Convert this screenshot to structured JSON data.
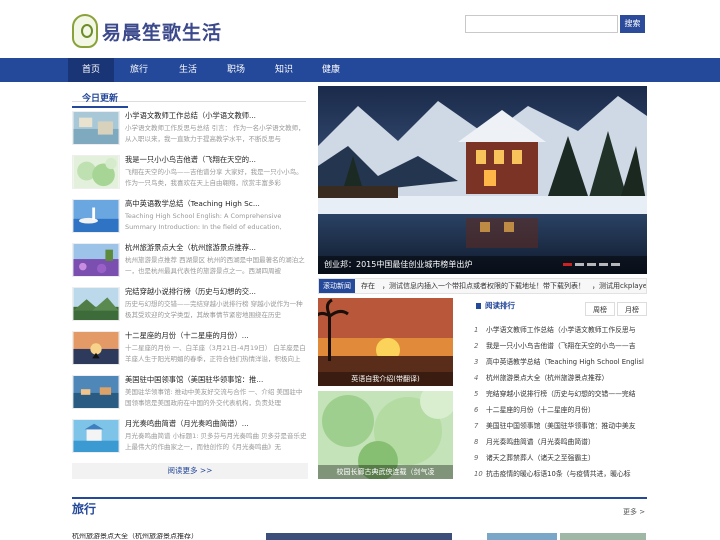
{
  "header": {
    "logo_text": "易晨笙歌生活",
    "search_placeholder": "",
    "search_button": "搜索"
  },
  "nav": [
    "首页",
    "旅行",
    "生活",
    "职场",
    "知识",
    "健康"
  ],
  "today": {
    "title": "今日更新",
    "items": [
      {
        "title": "小学语文教师工作总结（小学语文教师...",
        "desc": "小学语文教师工作反思与总结 引言： 作为一名小学语文教师，从入职以来，我一直致力于提高教学水平，不断反思与"
      },
      {
        "title": "我是一只小小鸟吉他谱（飞翔在天空的...",
        "desc": "飞翔在天空的小鸟——吉他谱分享 大家好，我是一只小小鸟。作为一只鸟类，我喜欢在天上自由翱翔，欣赏丰富多彩"
      },
      {
        "title": "高中英语教学总结（Teaching High Sc...",
        "desc": "Teaching High School English: A Comprehensive Summary Introduction: In the field of education, teaching"
      },
      {
        "title": "杭州旅游景点大全（杭州旅游景点推荐...",
        "desc": "杭州旅游景点推荐 西湖景区 杭州的西湖是中国最著名的湖泊之一，也是杭州最具代表性的旅游景点之一。西湖四周被"
      },
      {
        "title": "完结穿越小说排行榜（历史与幻想的交...",
        "desc": "历史与幻想的交错——完结穿越小说排行榜 穿越小说作为一种极其受欢迎的文学类型，其故事情节紧密地围绕在历史"
      },
      {
        "title": "十二星座的月份（十二星座的月份）...",
        "desc": "十二星座的月份 一、白羊座（3月21日-4月19日） 白羊座是白羊座人生于阳光明媚的春季，正符合他们热情洋溢，积极向上"
      },
      {
        "title": "美国驻中国领事馆（美国驻华领事馆：推...",
        "desc": "美国驻华领事馆: 推动中美友好交流与合作 一、介绍 美国驻中国领事馆是美国政府在中国的外交代表机构，负责处理"
      },
      {
        "title": "月光奏鸣曲简谱（月光奏鸣曲简谱）...",
        "desc": "月光奏鸣曲简谱 小标题1: 贝多芬与月光奏鸣曲 贝多芬是音乐史上最伟大的作曲家之一，而他创作的《月光奏鸣曲》无"
      }
    ],
    "more": "阅读更多 >>"
  },
  "slider": {
    "caption": "创业邦：2015中国最佳创业城市榜单出炉"
  },
  "ticker": {
    "label": "滚动新闻",
    "text": "存在　，测试信息内插入一个带扣点或者权限的下载地址！带下载列表！　，测试用ckplayer"
  },
  "pics": [
    {
      "caption": "英语自我介绍(带翻译)"
    },
    {
      "caption": "校园长廊古典武侠连载（剑气凌"
    }
  ],
  "ranking": {
    "title": "阅读排行",
    "tabs": [
      "周榜",
      "月榜"
    ],
    "items": [
      "小学语文教师工作总结（小学语文教师工作反思与",
      "我是一只小小鸟吉他谱（飞翔在天空的小鸟——吉",
      "高中英语教学总结（Teaching High School Englisl",
      "杭州旅游景点大全（杭州旅游景点推荐）",
      "完结穿越小说排行榜（历史与幻想的交错——完结",
      "十二星座的月份（十二星座的月份）",
      "美国驻中国领事馆（美国驻华领事馆：推动中美友",
      "月光奏鸣曲简谱（月光奏鸣曲简谱）",
      "诸天之葬禁葬人（诸天之至强霸主）",
      "抗击疫情的暖心标语10条（与疫情共进，暖心标"
    ]
  },
  "travel": {
    "title": "旅行",
    "more": "更多 >",
    "first_item": "杭州旅游景点大全（杭州旅游景点推荐）"
  }
}
